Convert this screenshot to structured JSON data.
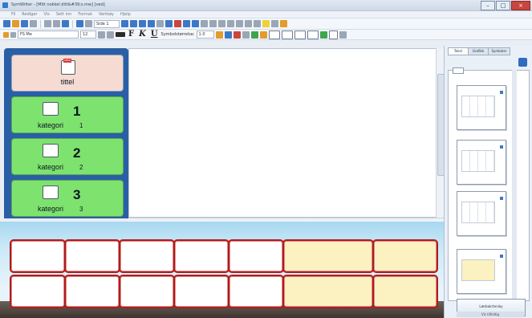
{
  "window": {
    "title": "SymWriter - [Mitt nokkel ditt&#39;s.mw] [ved]"
  },
  "menubar": {
    "items": [
      "Fil",
      "Rediger",
      "Vis",
      "Sett inn",
      "Format",
      "Verktøy",
      "Hjelp"
    ]
  },
  "toolbar2": {
    "zoom_value": "Side 1",
    "font_name": "FS Me",
    "font_size": "12",
    "symbol_size_label": "Symbolstørrelse:",
    "symbol_size_value": "1.0"
  },
  "left_cards": [
    {
      "label": "tittel"
    },
    {
      "label": "kategori",
      "number": "1",
      "small": "1"
    },
    {
      "label": "kategori",
      "number": "2",
      "small": "2"
    },
    {
      "label": "kategori",
      "number": "3",
      "small": "3"
    }
  ],
  "title_card_symbol_text": "ABCD",
  "right_panel": {
    "tabs": [
      "Tekst",
      "Grafikk",
      "Symboler"
    ],
    "button_label": "Lærbakrtenlay",
    "button2_label": "Vis tilfeldig"
  },
  "grid": {
    "rows": 2,
    "cells_per_row": 7,
    "yellow_from_index": 5
  },
  "colors": {
    "left_panel_bg": "#2a5fa6",
    "title_card_bg": "#f6dbd2",
    "category_card_bg": "#7ee26f",
    "grid_border": "#b01c1c",
    "grid_yellow": "#fbf1c1"
  },
  "icons": [
    "app-icon",
    "minimize-icon",
    "maximize-icon",
    "close-icon",
    "new-icon",
    "open-icon",
    "save-icon",
    "print-icon",
    "undo-icon",
    "redo-icon",
    "bold-icon",
    "italic-icon",
    "underline-icon",
    "font-color-icon",
    "symbol-icon"
  ]
}
